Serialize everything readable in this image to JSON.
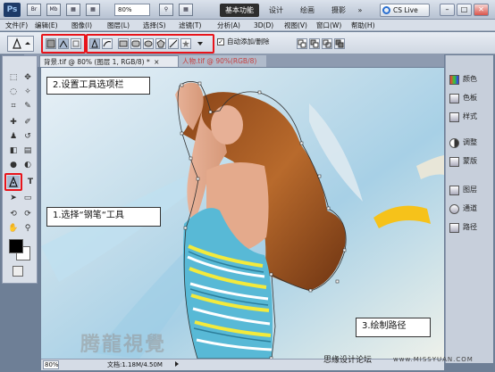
{
  "appbar": {
    "logo": "Ps",
    "icons": [
      "Br",
      "Mb",
      "▦",
      "▦",
      "⚲",
      "▦"
    ],
    "zoom": "80%",
    "workspaces": [
      "基本功能",
      "设计",
      "绘画",
      "摄影",
      "»"
    ],
    "cslive": "CS Live"
  },
  "window_controls": [
    "–",
    "□",
    "✕"
  ],
  "menu": [
    "文件(F)",
    "编辑(E)",
    "图像(I)",
    "图层(L)",
    "选择(S)",
    "滤镜(T)",
    "分析(A)",
    "3D(D)",
    "视图(V)",
    "窗口(W)",
    "帮助(H)"
  ],
  "options": {
    "auto_add_delete_checked": true,
    "auto_add_delete": "自动添加/删除"
  },
  "tabs": [
    {
      "label": "背景.tif @ 80% (图层 1, RGB/8) *",
      "close": "×",
      "active": true
    },
    {
      "label": "人物.tif @ 90%(RGB/8)",
      "close": "×",
      "active": false
    }
  ],
  "panels": [
    {
      "label": "颜色"
    },
    {
      "label": "色板"
    },
    {
      "label": "样式"
    },
    {
      "label": "调整"
    },
    {
      "label": "蒙版"
    },
    {
      "label": "图层"
    },
    {
      "label": "通道"
    },
    {
      "label": "路径"
    }
  ],
  "callouts": {
    "step1": "1.选择“钢笔“工具",
    "step2": "2.设置工具选项栏",
    "step3": "3.绘制路径"
  },
  "status": {
    "zoom": "80%",
    "doc": "文档:1.18M/4.50M"
  },
  "watermark": "腾龍視覺",
  "footer": {
    "text": "思缘设计论坛",
    "site": "www.MISSYUAN.COM"
  },
  "colors": {
    "highlight": "#e8141b",
    "foreground": "#000000",
    "background": "#ffffff"
  }
}
